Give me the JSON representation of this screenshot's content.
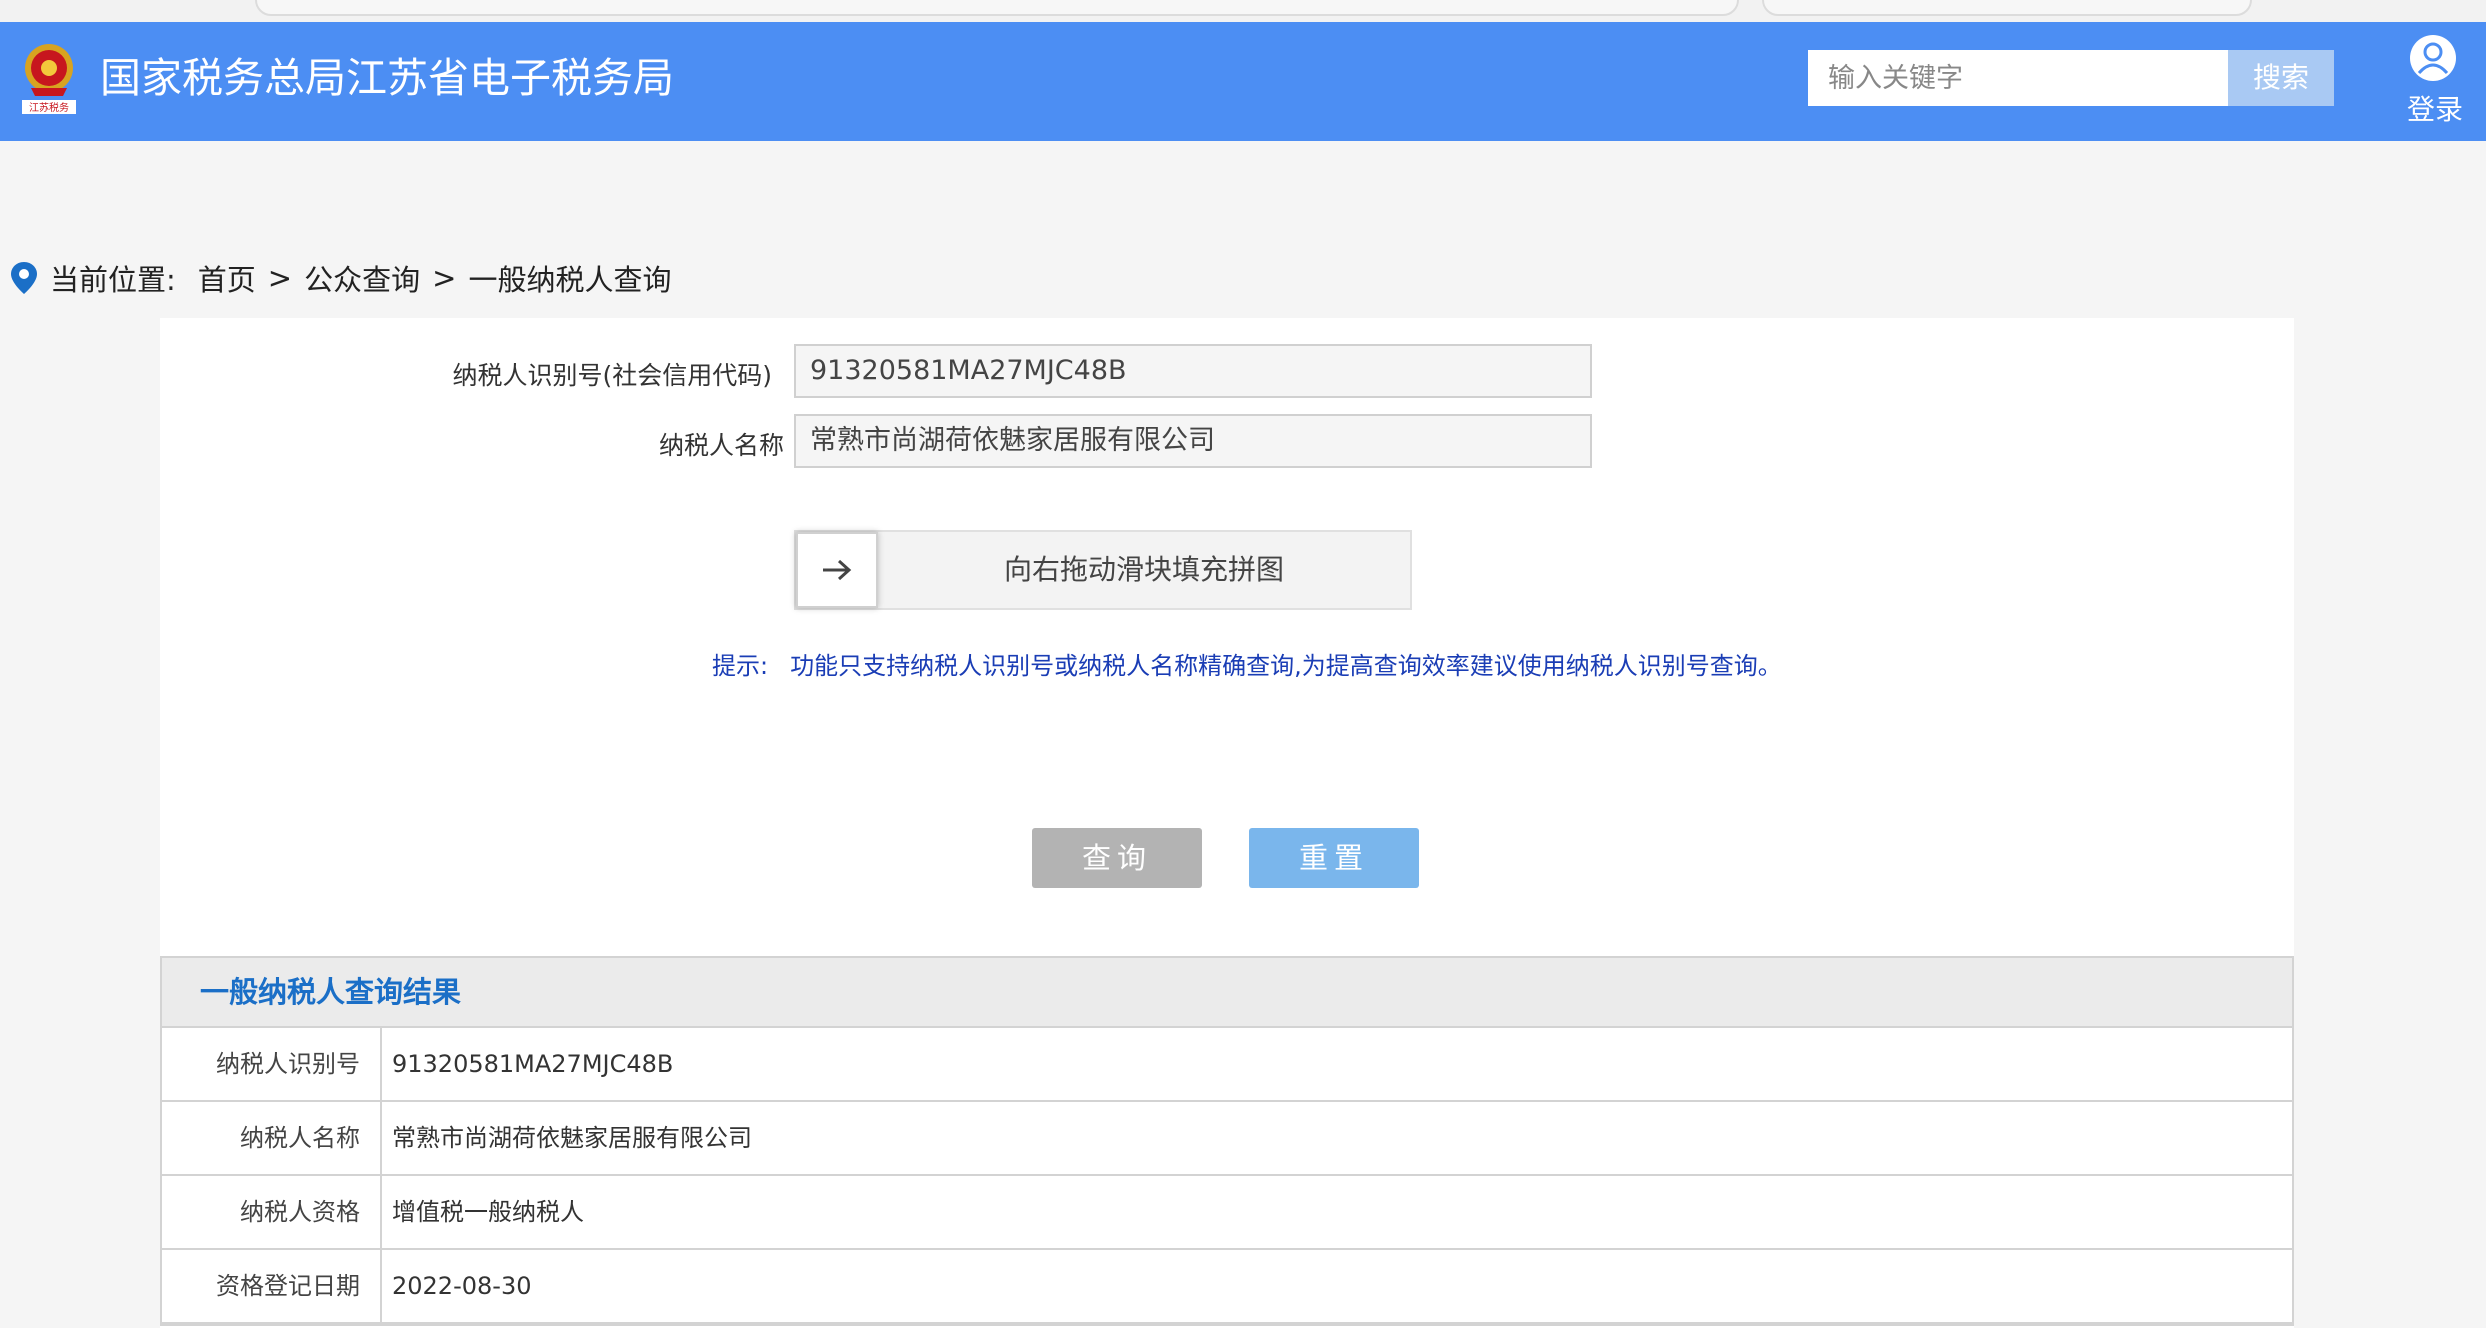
{
  "header": {
    "site_title": "国家税务总局江苏省电子税务局",
    "emblem_text": "江苏税务",
    "search_placeholder": "输入关键字",
    "search_button": "搜索",
    "login_label": "登录"
  },
  "breadcrumb": {
    "label": "当前位置:",
    "items": [
      "首页",
      "公众查询",
      "一般纳税人查询"
    ],
    "separator": ">"
  },
  "form": {
    "taxpayer_id_label": "纳税人识别号(社会信用代码)",
    "taxpayer_id_value": "91320581MA27MJC48B",
    "taxpayer_name_label": "纳税人名称",
    "taxpayer_name_value": "常熟市尚湖荷依魅家居服有限公司",
    "slider_text": "向右拖动滑块填充拼图",
    "hint_label": "提示:",
    "hint_text": "功能只支持纳税人识别号或纳税人名称精确查询,为提高查询效率建议使用纳税人识别号查询。",
    "query_button": "查询",
    "reset_button": "重置"
  },
  "result": {
    "title": "一般纳税人查询结果",
    "rows": [
      {
        "key": "纳税人识别号",
        "value": "91320581MA27MJC48B"
      },
      {
        "key": "纳税人名称",
        "value": "常熟市尚湖荷依魅家居服有限公司"
      },
      {
        "key": "纳税人资格",
        "value": "增值税一般纳税人"
      },
      {
        "key": "资格登记日期",
        "value": "2022-08-30"
      }
    ]
  },
  "colors": {
    "header_bg": "#4c8ef3",
    "result_title": "#1b6fc7",
    "hint": "#1a3db5"
  }
}
